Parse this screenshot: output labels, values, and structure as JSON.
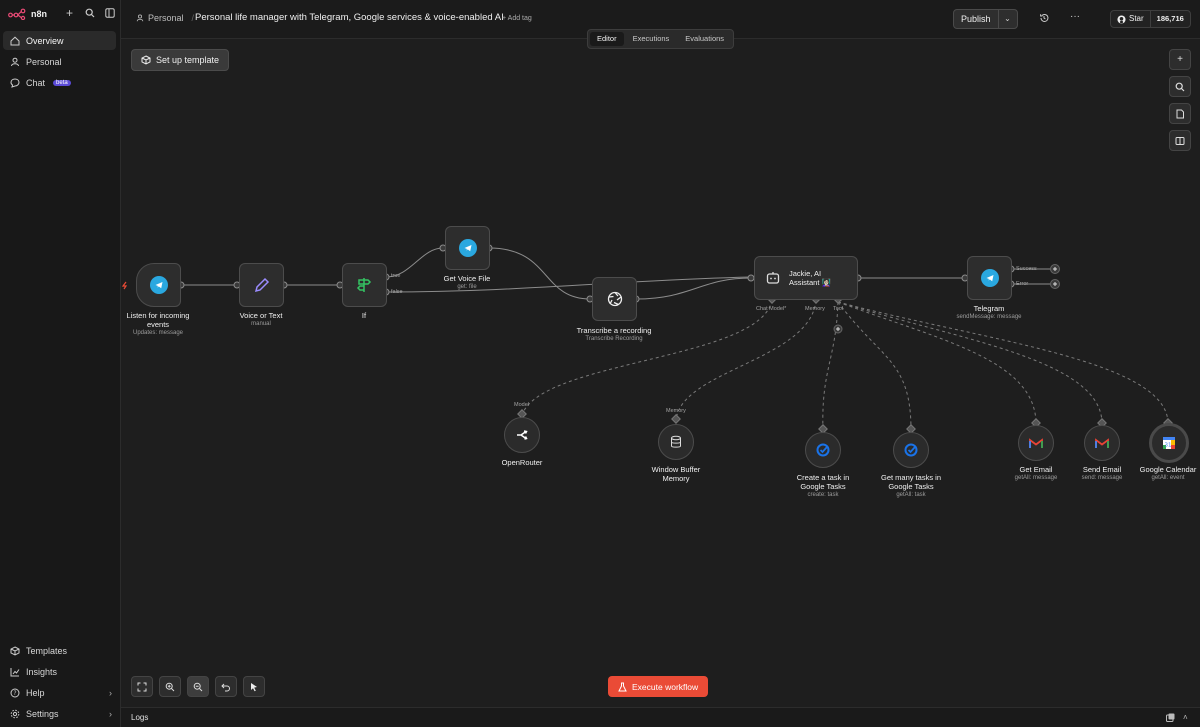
{
  "app": {
    "name": "n8n"
  },
  "sidebar": {
    "items": [
      {
        "label": "Overview",
        "icon": "home-icon",
        "active": true
      },
      {
        "label": "Personal",
        "icon": "user-icon"
      },
      {
        "label": "Chat",
        "icon": "chat-icon",
        "badge": "beta"
      }
    ],
    "bottom": [
      {
        "label": "Templates",
        "icon": "template-icon"
      },
      {
        "label": "Insights",
        "icon": "insights-icon"
      },
      {
        "label": "Help",
        "icon": "help-icon",
        "chevron": true
      },
      {
        "label": "Settings",
        "icon": "gear-icon",
        "chevron": true
      }
    ]
  },
  "header": {
    "breadcrumb": "Personal",
    "title": "Personal life manager with Telegram, Google services & voice-enabled AI",
    "add_tag": "+ Add tag",
    "publish": "Publish",
    "github_star": "Star",
    "github_count": "186,716"
  },
  "tabs": [
    "Editor",
    "Executions",
    "Evaluations"
  ],
  "canvas": {
    "setup_template": "Set up template",
    "execute": "Execute workflow",
    "nodes": {
      "listen": {
        "title": "Listen for incoming events",
        "sub": "Updates: message"
      },
      "voice_text": {
        "title": "Voice or Text",
        "sub": "manual"
      },
      "if": {
        "title": "If",
        "out_true": "true",
        "out_false": "false"
      },
      "get_voice": {
        "title": "Get Voice File",
        "sub": "get: file"
      },
      "transcribe": {
        "title": "Transcribe a recording",
        "sub": "Transcribe Recording"
      },
      "agent": {
        "title": "Jackie, AI Assistant 👩🏻‍🏫",
        "port_model": "Chat Model*",
        "port_memory": "Memory",
        "port_tool": "Tool"
      },
      "telegram": {
        "title": "Telegram",
        "sub": "sendMessage: message",
        "out_success": "Success",
        "out_error": "Error"
      },
      "openrouter": {
        "title": "OpenRouter",
        "port": "Model"
      },
      "memory": {
        "title": "Window Buffer Memory",
        "port": "Memory"
      },
      "create_task": {
        "title": "Create a task in Google Tasks",
        "sub": "create: task"
      },
      "get_tasks": {
        "title": "Get many tasks in Google Tasks",
        "sub": "getAll: task"
      },
      "get_email": {
        "title": "Get Email",
        "sub": "getAll: message"
      },
      "send_email": {
        "title": "Send Email",
        "sub": "send: message"
      },
      "gcal": {
        "title": "Google Calendar",
        "sub": "getAll: event"
      }
    }
  },
  "logs": {
    "label": "Logs"
  },
  "colors": {
    "accent": "#ea4b36",
    "telegram": "#2aa8e0",
    "google_tasks": "#1a73e8",
    "background": "#1e1e1e"
  }
}
